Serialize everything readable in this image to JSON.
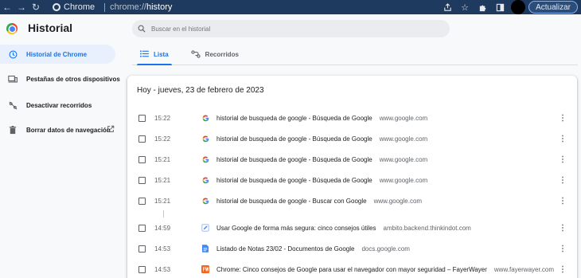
{
  "browser": {
    "site_label": "Chrome",
    "url_scheme": "chrome://",
    "url_host": "history",
    "update_label": "Actualizar"
  },
  "header": {
    "title": "Historial",
    "search_placeholder": "Buscar en el historial"
  },
  "sidebar": {
    "items": [
      {
        "label": "Historial de Chrome",
        "icon": "clock-icon"
      },
      {
        "label": "Pestañas de otros dispositivos",
        "icon": "devices-icon"
      },
      {
        "label": "Desactivar recorridos",
        "icon": "journeys-off-icon"
      },
      {
        "label": "Borrar datos de navegación",
        "icon": "trash-icon"
      }
    ]
  },
  "tabs": [
    {
      "label": "Lista",
      "icon": "list-icon"
    },
    {
      "label": "Recorridos",
      "icon": "journeys-icon"
    }
  ],
  "history": {
    "date_heading": "Hoy - jueves, 23 de febrero de 2023",
    "entries": [
      {
        "time": "15:22",
        "title": "historial de busqueda de google - Búsqueda de Google",
        "domain": "www.google.com",
        "icon": "google-icon"
      },
      {
        "time": "15:22",
        "title": "historial de busqueda de google - Búsqueda de Google",
        "domain": "www.google.com",
        "icon": "google-icon"
      },
      {
        "time": "15:21",
        "title": "historial de busqueda de google - Búsqueda de Google",
        "domain": "www.google.com",
        "icon": "google-icon"
      },
      {
        "time": "15:21",
        "title": "historial de busqueda de google - Búsqueda de Google",
        "domain": "www.google.com",
        "icon": "google-icon"
      },
      {
        "time": "15:21",
        "title": "historial de busqueda de google - Buscar con Google",
        "domain": "www.google.com",
        "icon": "google-icon"
      },
      {
        "time": "14:59",
        "title": "Usar Google de forma más segura: cinco consejos útiles",
        "domain": "ambito.backend.thinkindot.com",
        "icon": "edit-icon"
      },
      {
        "time": "14:53",
        "title": "Listado de Notas 23/02 - Documentos de Google",
        "domain": "docs.google.com",
        "icon": "docs-icon"
      },
      {
        "time": "14:53",
        "title": "Chrome: Cinco consejos de Google para usar el navegador con mayor seguridad – FayerWayer",
        "domain": "www.fayerwayer.com",
        "icon": "fw-icon"
      }
    ]
  },
  "colors": {
    "accent": "#1a73e8",
    "topbar": "#1f3a5f",
    "active_bg": "#e8f0fe"
  }
}
